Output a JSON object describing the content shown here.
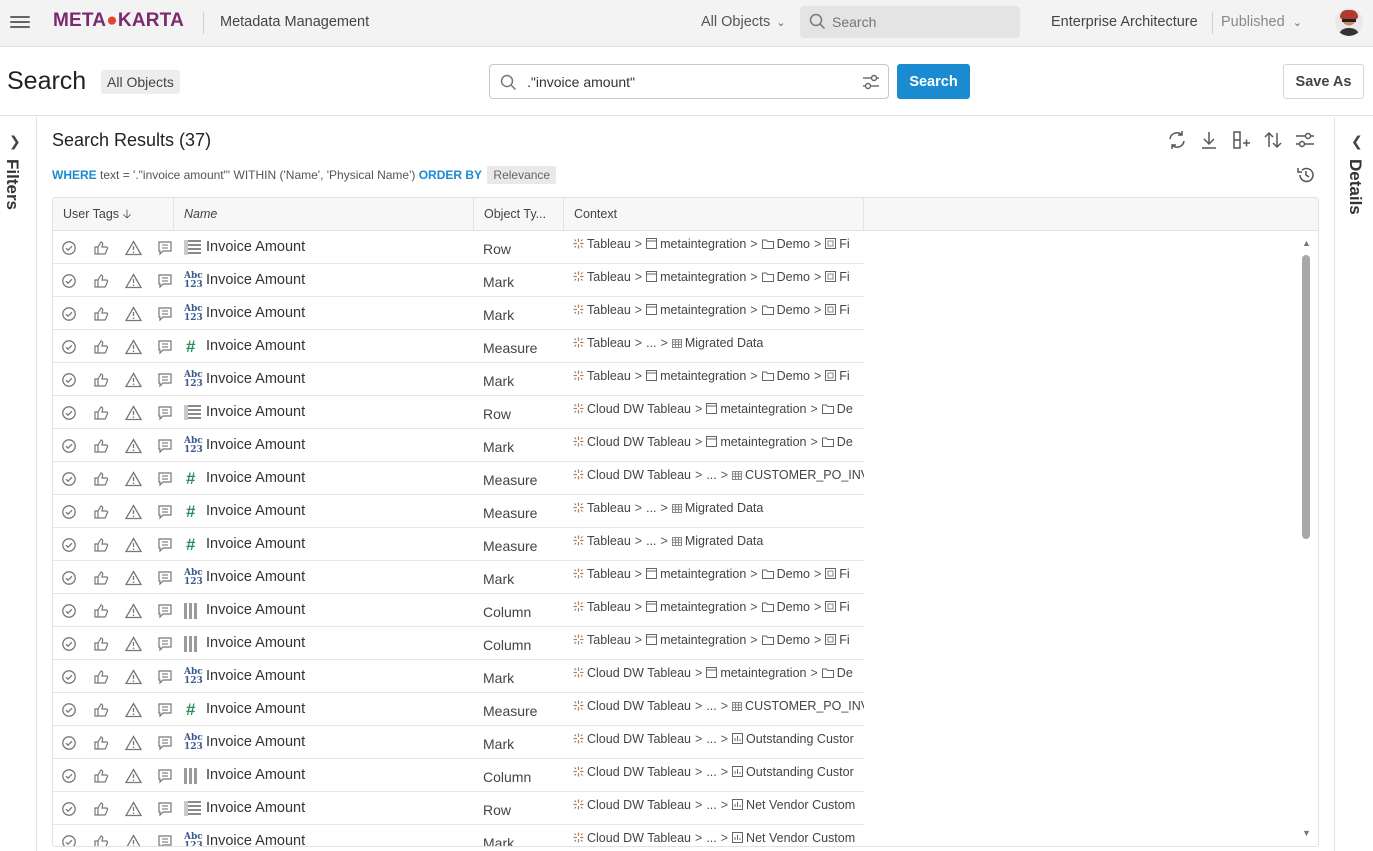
{
  "topbar": {
    "logo_part1": "META",
    "logo_part2": "KARTA",
    "app_title": "Metadata Management",
    "scope": "All Objects",
    "search_placeholder": "Search",
    "architecture": "Enterprise Architecture",
    "status": "Published"
  },
  "header": {
    "title": "Search",
    "scope_chip": "All Objects",
    "query": ".\"invoice amount\"",
    "search_button": "Search",
    "save_as_button": "Save As"
  },
  "panels": {
    "filters_label": "Filters",
    "details_label": "Details"
  },
  "results": {
    "title": "Search Results (37)",
    "where_kw": "WHERE",
    "where_text": "text = '.\"invoice amount\"' WITHIN ('Name', 'Physical Name')",
    "order_kw": "ORDER BY",
    "order_value": "Relevance"
  },
  "columns": [
    "User Tags",
    "Name",
    "Object Ty...",
    "Context"
  ],
  "colors": {
    "accent": "#1a8ad1",
    "measure_icon": "#2f8f5b",
    "brand": "#7b2a6e"
  },
  "rows": [
    {
      "icon": "row",
      "name": "Invoice Amount",
      "type": "Row",
      "context": [
        [
          "tableau-icon",
          "Tableau"
        ],
        [
          "model-icon",
          "metaintegration"
        ],
        [
          "folder-icon",
          "Demo"
        ],
        [
          "file-icon",
          "Fi"
        ]
      ]
    },
    {
      "icon": "abc",
      "name": "Invoice Amount",
      "type": "Mark",
      "context": [
        [
          "tableau-icon",
          "Tableau"
        ],
        [
          "model-icon",
          "metaintegration"
        ],
        [
          "folder-icon",
          "Demo"
        ],
        [
          "file-icon",
          "Fi"
        ]
      ]
    },
    {
      "icon": "abc",
      "name": "Invoice Amount",
      "type": "Mark",
      "context": [
        [
          "tableau-icon",
          "Tableau"
        ],
        [
          "model-icon",
          "metaintegration"
        ],
        [
          "folder-icon",
          "Demo"
        ],
        [
          "file-icon",
          "Fi"
        ]
      ]
    },
    {
      "icon": "hash",
      "name": "Invoice Amount",
      "type": "Measure",
      "context": [
        [
          "tableau-icon",
          "Tableau"
        ],
        [
          "",
          "..."
        ],
        [
          "table-icon",
          "Migrated Data"
        ]
      ]
    },
    {
      "icon": "abc",
      "name": "Invoice Amount",
      "type": "Mark",
      "context": [
        [
          "tableau-icon",
          "Tableau"
        ],
        [
          "model-icon",
          "metaintegration"
        ],
        [
          "folder-icon",
          "Demo"
        ],
        [
          "file-icon",
          "Fi"
        ]
      ]
    },
    {
      "icon": "row",
      "name": "Invoice Amount",
      "type": "Row",
      "context": [
        [
          "tableau-icon",
          "Cloud DW Tableau"
        ],
        [
          "model-icon",
          "metaintegration"
        ],
        [
          "folder-icon",
          "De"
        ]
      ]
    },
    {
      "icon": "abc",
      "name": "Invoice Amount",
      "type": "Mark",
      "context": [
        [
          "tableau-icon",
          "Cloud DW Tableau"
        ],
        [
          "model-icon",
          "metaintegration"
        ],
        [
          "folder-icon",
          "De"
        ]
      ]
    },
    {
      "icon": "hash",
      "name": "Invoice Amount",
      "type": "Measure",
      "context": [
        [
          "tableau-icon",
          "Cloud DW Tableau"
        ],
        [
          "",
          "..."
        ],
        [
          "table-icon",
          "CUSTOMER_PO_INV"
        ]
      ]
    },
    {
      "icon": "hash",
      "name": "Invoice Amount",
      "type": "Measure",
      "context": [
        [
          "tableau-icon",
          "Tableau"
        ],
        [
          "",
          "..."
        ],
        [
          "table-icon",
          "Migrated Data"
        ]
      ]
    },
    {
      "icon": "hash",
      "name": "Invoice Amount",
      "type": "Measure",
      "context": [
        [
          "tableau-icon",
          "Tableau"
        ],
        [
          "",
          "..."
        ],
        [
          "table-icon",
          "Migrated Data"
        ]
      ]
    },
    {
      "icon": "abc",
      "name": "Invoice Amount",
      "type": "Mark",
      "context": [
        [
          "tableau-icon",
          "Tableau"
        ],
        [
          "model-icon",
          "metaintegration"
        ],
        [
          "folder-icon",
          "Demo"
        ],
        [
          "file-icon",
          "Fi"
        ]
      ]
    },
    {
      "icon": "col",
      "name": "Invoice Amount",
      "type": "Column",
      "context": [
        [
          "tableau-icon",
          "Tableau"
        ],
        [
          "model-icon",
          "metaintegration"
        ],
        [
          "folder-icon",
          "Demo"
        ],
        [
          "file-icon",
          "Fi"
        ]
      ]
    },
    {
      "icon": "col",
      "name": "Invoice Amount",
      "type": "Column",
      "context": [
        [
          "tableau-icon",
          "Tableau"
        ],
        [
          "model-icon",
          "metaintegration"
        ],
        [
          "folder-icon",
          "Demo"
        ],
        [
          "file-icon",
          "Fi"
        ]
      ]
    },
    {
      "icon": "abc",
      "name": "Invoice Amount",
      "type": "Mark",
      "context": [
        [
          "tableau-icon",
          "Cloud DW Tableau"
        ],
        [
          "model-icon",
          "metaintegration"
        ],
        [
          "folder-icon",
          "De"
        ]
      ]
    },
    {
      "icon": "hash",
      "name": "Invoice Amount",
      "type": "Measure",
      "context": [
        [
          "tableau-icon",
          "Cloud DW Tableau"
        ],
        [
          "",
          "..."
        ],
        [
          "table-icon",
          "CUSTOMER_PO_INV"
        ]
      ]
    },
    {
      "icon": "abc",
      "name": "Invoice Amount",
      "type": "Mark",
      "context": [
        [
          "tableau-icon",
          "Cloud DW Tableau"
        ],
        [
          "",
          "..."
        ],
        [
          "report-icon",
          "Outstanding Custor"
        ]
      ]
    },
    {
      "icon": "col",
      "name": "Invoice Amount",
      "type": "Column",
      "context": [
        [
          "tableau-icon",
          "Cloud DW Tableau"
        ],
        [
          "",
          "..."
        ],
        [
          "report-icon",
          "Outstanding Custor"
        ]
      ]
    },
    {
      "icon": "row",
      "name": "Invoice Amount",
      "type": "Row",
      "context": [
        [
          "tableau-icon",
          "Cloud DW Tableau"
        ],
        [
          "",
          "..."
        ],
        [
          "report-icon",
          "Net Vendor Custom"
        ]
      ]
    },
    {
      "icon": "abc",
      "name": "Invoice Amount",
      "type": "Mark",
      "context": [
        [
          "tableau-icon",
          "Cloud DW Tableau"
        ],
        [
          "",
          "..."
        ],
        [
          "report-icon",
          "Net Vendor Custom"
        ]
      ]
    }
  ]
}
